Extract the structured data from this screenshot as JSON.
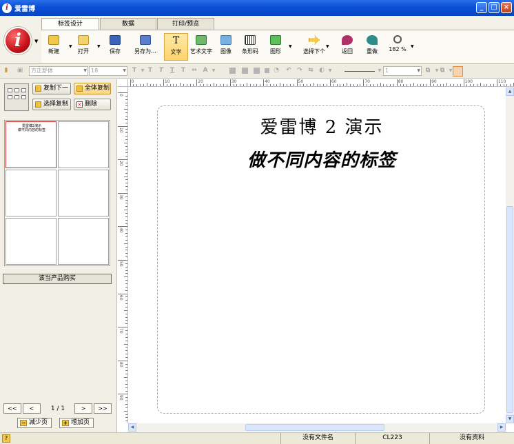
{
  "window": {
    "title": "爱雷博"
  },
  "ribbon": {
    "tabs": [
      "标签设计",
      "数据",
      "打印/预览"
    ],
    "buttons": {
      "new": "新建",
      "open": "打开",
      "save": "保存",
      "save_as": "另存为...",
      "text": "文字",
      "art_text": "艺术文字",
      "image": "图像",
      "barcode": "条形码",
      "shape": "图形",
      "select_next": "选择下个",
      "undo": "返回",
      "redo": "重做",
      "zoom": "182 %"
    }
  },
  "format_toolbar": {
    "font": "方正舒体",
    "size": "18",
    "line_width": "1"
  },
  "left_panel": {
    "copy_next": "复制下一",
    "copy_all": "全体复制",
    "select_copy": "选择复制",
    "delete": "删除",
    "buy_button": "该当产品购买",
    "page_indicator": "1 / 1",
    "reduce_page": "减少页",
    "add_page": "增加页",
    "nav": {
      "first": "<<",
      "prev": "<",
      "next": ">",
      "last": ">>"
    },
    "thumbnail": {
      "line1": "爱雷博2演示",
      "line2": "做不同内容的标签"
    }
  },
  "canvas": {
    "line1": "爱雷博 2 演示",
    "line2": "做不同内容的标签"
  },
  "ruler": {
    "top_labels": [
      "0",
      "10",
      "20",
      "30",
      "40",
      "50",
      "60",
      "70",
      "80",
      "90",
      "100",
      "110"
    ],
    "left_labels": [
      "0",
      "10",
      "20",
      "30",
      "40",
      "50",
      "60",
      "70",
      "80",
      "90"
    ]
  },
  "status_bar": {
    "file": "没有文件名",
    "printer": "CL223",
    "data": "没有资料"
  }
}
